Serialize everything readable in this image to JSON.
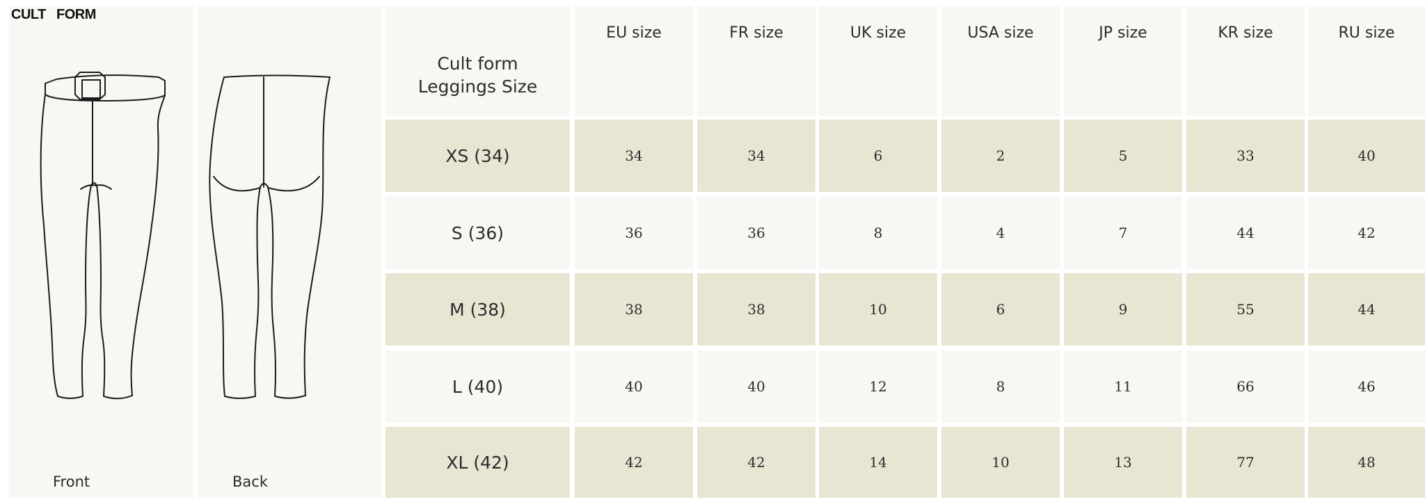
{
  "brand": {
    "logo": "CULT   FORM"
  },
  "illustrations": {
    "front_label": "Front",
    "back_label": "Back"
  },
  "table": {
    "corner_label": "Cult form\nLeggings Size",
    "columns": [
      "EU size",
      "FR size",
      "UK size",
      "USA  size",
      "JP size",
      "KR size",
      "RU size"
    ],
    "rows": [
      {
        "size": "XS (34)",
        "values": [
          "34",
          "34",
          "6",
          "2",
          "5",
          "33",
          "40"
        ]
      },
      {
        "size": "S (36)",
        "values": [
          "36",
          "36",
          "8",
          "4",
          "7",
          "44",
          "42"
        ]
      },
      {
        "size": "M (38)",
        "values": [
          "38",
          "38",
          "10",
          "6",
          "9",
          "55",
          "44"
        ]
      },
      {
        "size": "L (40)",
        "values": [
          "40",
          "40",
          "12",
          "8",
          "11",
          "66",
          "46"
        ]
      },
      {
        "size": "XL (42)",
        "values": [
          "42",
          "42",
          "14",
          "10",
          "13",
          "77",
          "48"
        ]
      }
    ]
  },
  "colors": {
    "light_cell": "#f8f7f3",
    "tan_cell": "#e9e5d3",
    "line": "#1a1a1a"
  }
}
